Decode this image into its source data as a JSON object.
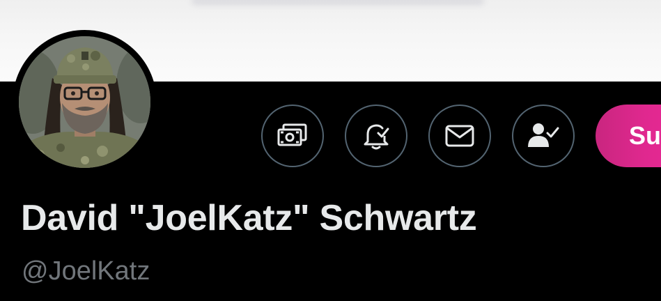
{
  "profile": {
    "display_name": "David \"JoelKatz\" Schwartz",
    "handle": "@JoelKatz"
  },
  "actions": {
    "items": [
      {
        "icon": "money-icon"
      },
      {
        "icon": "bell-check-icon"
      },
      {
        "icon": "mail-icon"
      },
      {
        "icon": "person-check-icon"
      }
    ],
    "subscribe_label": "Su"
  },
  "colors": {
    "background": "#000000",
    "banner": "#f5f5f5",
    "name_text": "#e7e9ea",
    "handle_text": "#71767b",
    "button_border": "#536471",
    "subscribe_gradient_start": "#c9267f",
    "subscribe_gradient_end": "#f02a9a"
  }
}
